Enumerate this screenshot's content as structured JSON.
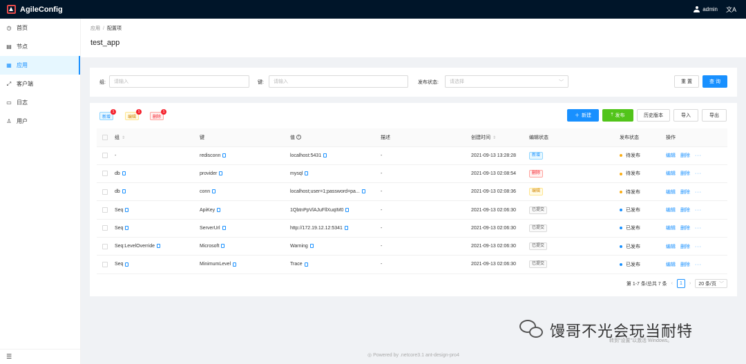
{
  "app": {
    "title": "AgileConfig",
    "user": "admin",
    "lang_icon": "translate-icon"
  },
  "sidebar": {
    "items": [
      {
        "label": "首页",
        "icon": "dashboard-icon",
        "glyph": "◷",
        "active": false
      },
      {
        "label": "节点",
        "icon": "node-icon",
        "glyph": "▤",
        "active": false
      },
      {
        "label": "应用",
        "icon": "appstore-icon",
        "glyph": "▦",
        "active": true
      },
      {
        "label": "客户端",
        "icon": "client-icon",
        "glyph": "⤢",
        "active": false
      },
      {
        "label": "日志",
        "icon": "log-icon",
        "glyph": "▭",
        "active": false
      },
      {
        "label": "用户",
        "icon": "user-icon",
        "glyph": "♙",
        "active": false
      }
    ],
    "collapse_glyph": "☰"
  },
  "breadcrumb": {
    "parent": "应用",
    "sep": "/",
    "current": "配置项"
  },
  "page_title": "test_app",
  "filter": {
    "group_label": "组:",
    "group_placeholder": "请输入",
    "key_label": "键:",
    "key_placeholder": "请输入",
    "status_label": "发布状态:",
    "status_placeholder": "请选择",
    "reset": "重 置",
    "query": "查 询"
  },
  "badges": [
    {
      "label": "新增",
      "count": "1"
    },
    {
      "label": "编辑",
      "count": "1"
    },
    {
      "label": "删除",
      "count": "1"
    }
  ],
  "toolbar": {
    "new": "新建",
    "publish": "发布",
    "history": "历史版本",
    "import": "导入",
    "export": "导出"
  },
  "columns": {
    "group": "组",
    "key": "键",
    "value": "值",
    "desc": "描述",
    "created": "创建时间",
    "edit_status": "编辑状态",
    "pub_status": "发布状态",
    "ops": "操作"
  },
  "rows": [
    {
      "group": "-",
      "group_copy": false,
      "key": "redisconn",
      "value": "localhost:5431",
      "desc": "-",
      "created": "2021-09-13 13:28:28",
      "edit": "新增",
      "edit_kind": "new",
      "pub": "待发布",
      "pub_color": "#faad14"
    },
    {
      "group": "db",
      "group_copy": true,
      "key": "provider",
      "value": "mysql",
      "desc": "-",
      "created": "2021-09-13 02:08:54",
      "edit": "删除",
      "edit_kind": "del",
      "pub": "待发布",
      "pub_color": "#faad14"
    },
    {
      "group": "db",
      "group_copy": true,
      "key": "conn",
      "value": "localhost;user=1;password=pa...",
      "desc": "-",
      "created": "2021-09-13 02:08:36",
      "edit": "编辑",
      "edit_kind": "edit",
      "pub": "待发布",
      "pub_color": "#faad14"
    },
    {
      "group": "Seq",
      "group_copy": true,
      "key": "ApiKey",
      "value": "1QbtnPpVlAJuFllXuqIM0",
      "desc": "-",
      "created": "2021-09-13 02:06:30",
      "edit": "已提交",
      "edit_kind": "done",
      "pub": "已发布",
      "pub_color": "#1890ff"
    },
    {
      "group": "Seq",
      "group_copy": true,
      "key": "ServerUrl",
      "value": "http://172.19.12.12:5341",
      "desc": "-",
      "created": "2021-09-13 02:06:30",
      "edit": "已提交",
      "edit_kind": "done",
      "pub": "已发布",
      "pub_color": "#1890ff"
    },
    {
      "group": "Seq:LevelOverride",
      "group_copy": true,
      "key": "Microsoft",
      "value": "Warning",
      "desc": "-",
      "created": "2021-09-13 02:06:30",
      "edit": "已提交",
      "edit_kind": "done",
      "pub": "已发布",
      "pub_color": "#1890ff"
    },
    {
      "group": "Seq",
      "group_copy": true,
      "key": "MinimumLevel",
      "value": "Trace",
      "desc": "-",
      "created": "2021-09-13 02:06:30",
      "edit": "已提交",
      "edit_kind": "done",
      "pub": "已发布",
      "pub_color": "#1890ff"
    }
  ],
  "row_ops": {
    "edit": "编辑",
    "delete": "删除",
    "more": "···"
  },
  "pagination": {
    "summary": "第 1-7 条/总共 7 条",
    "current": "1",
    "page_size": "20 条/页"
  },
  "footer": "Powered by .netcore3.1 ant-design-pro4",
  "watermark": {
    "text": "馒哥不光会玩当耐特",
    "sub": "转到\"设置\"以激活 Windows。"
  }
}
